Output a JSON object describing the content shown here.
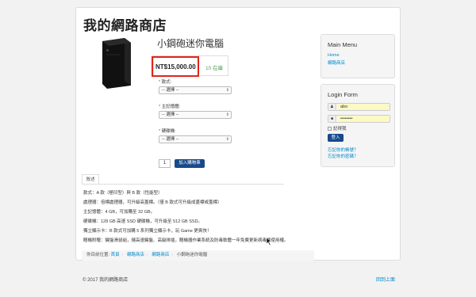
{
  "site": {
    "title": "我的網路商店"
  },
  "product": {
    "name": "小鋼砲迷你電腦",
    "price": "NT$15,000.00",
    "stock": "10 在庫",
    "options": [
      {
        "label": "款式:",
        "placeholder": "-- 選擇 --"
      },
      {
        "label": "主記憶體:",
        "placeholder": "-- 選擇 --"
      },
      {
        "label": "硬碟機:",
        "placeholder": "-- 選擇 --"
      }
    ],
    "quantity": "1",
    "add_to_cart_label": "加入購物車"
  },
  "tabs": {
    "description_label": "敘述"
  },
  "description": [
    "款式：A 款（極印型）與 B 款（性能型）",
    "處理器：倍標處理器，可升級高蓋標。（僅 B 款式可升級成蓋標或蓋標）",
    "主記憶體：4 GB，可加購至 32 GB。",
    "硬碟機：128 GB 高速 SSD 硬碟機，可升級至 512 GB SSD。",
    "獨立顯示卡：B 款式可加購 5 系列獨立顯示卡，玩 Game 更爽快！",
    "贈機附贈：鍵盤滑鼠組，鏈高速鍵盤、高級排插，贈機器作業系統及防毒軟體一年免費更新病毒碼使用權。"
  ],
  "breadcrumb": {
    "prefix": "你目前位置:",
    "items": [
      "首頁",
      "網路商店",
      "網路商店"
    ],
    "current": "小鋼砲迷你電腦",
    "separator": "›"
  },
  "main_menu": {
    "title": "Main Menu",
    "items": [
      "Home",
      "網路商店"
    ]
  },
  "login_form": {
    "title": "Login Form",
    "username": "abo",
    "password": "••••••••",
    "remember_label": "記得我",
    "login_label": "登入",
    "forgot_username": "忘記你的帳號？",
    "forgot_password": "忘記你的密碼？",
    "user_icon": "user-icon",
    "lock_icon": "lock-icon"
  },
  "footer": {
    "copyright": "© 2017 我的網路商店",
    "back_to_top": "回到上面"
  },
  "colors": {
    "accent": "#174a8a",
    "link": "#0088cc",
    "highlight_border": "#e0261b",
    "stock": "#5aa05a",
    "autofill": "#fbf9c4"
  }
}
